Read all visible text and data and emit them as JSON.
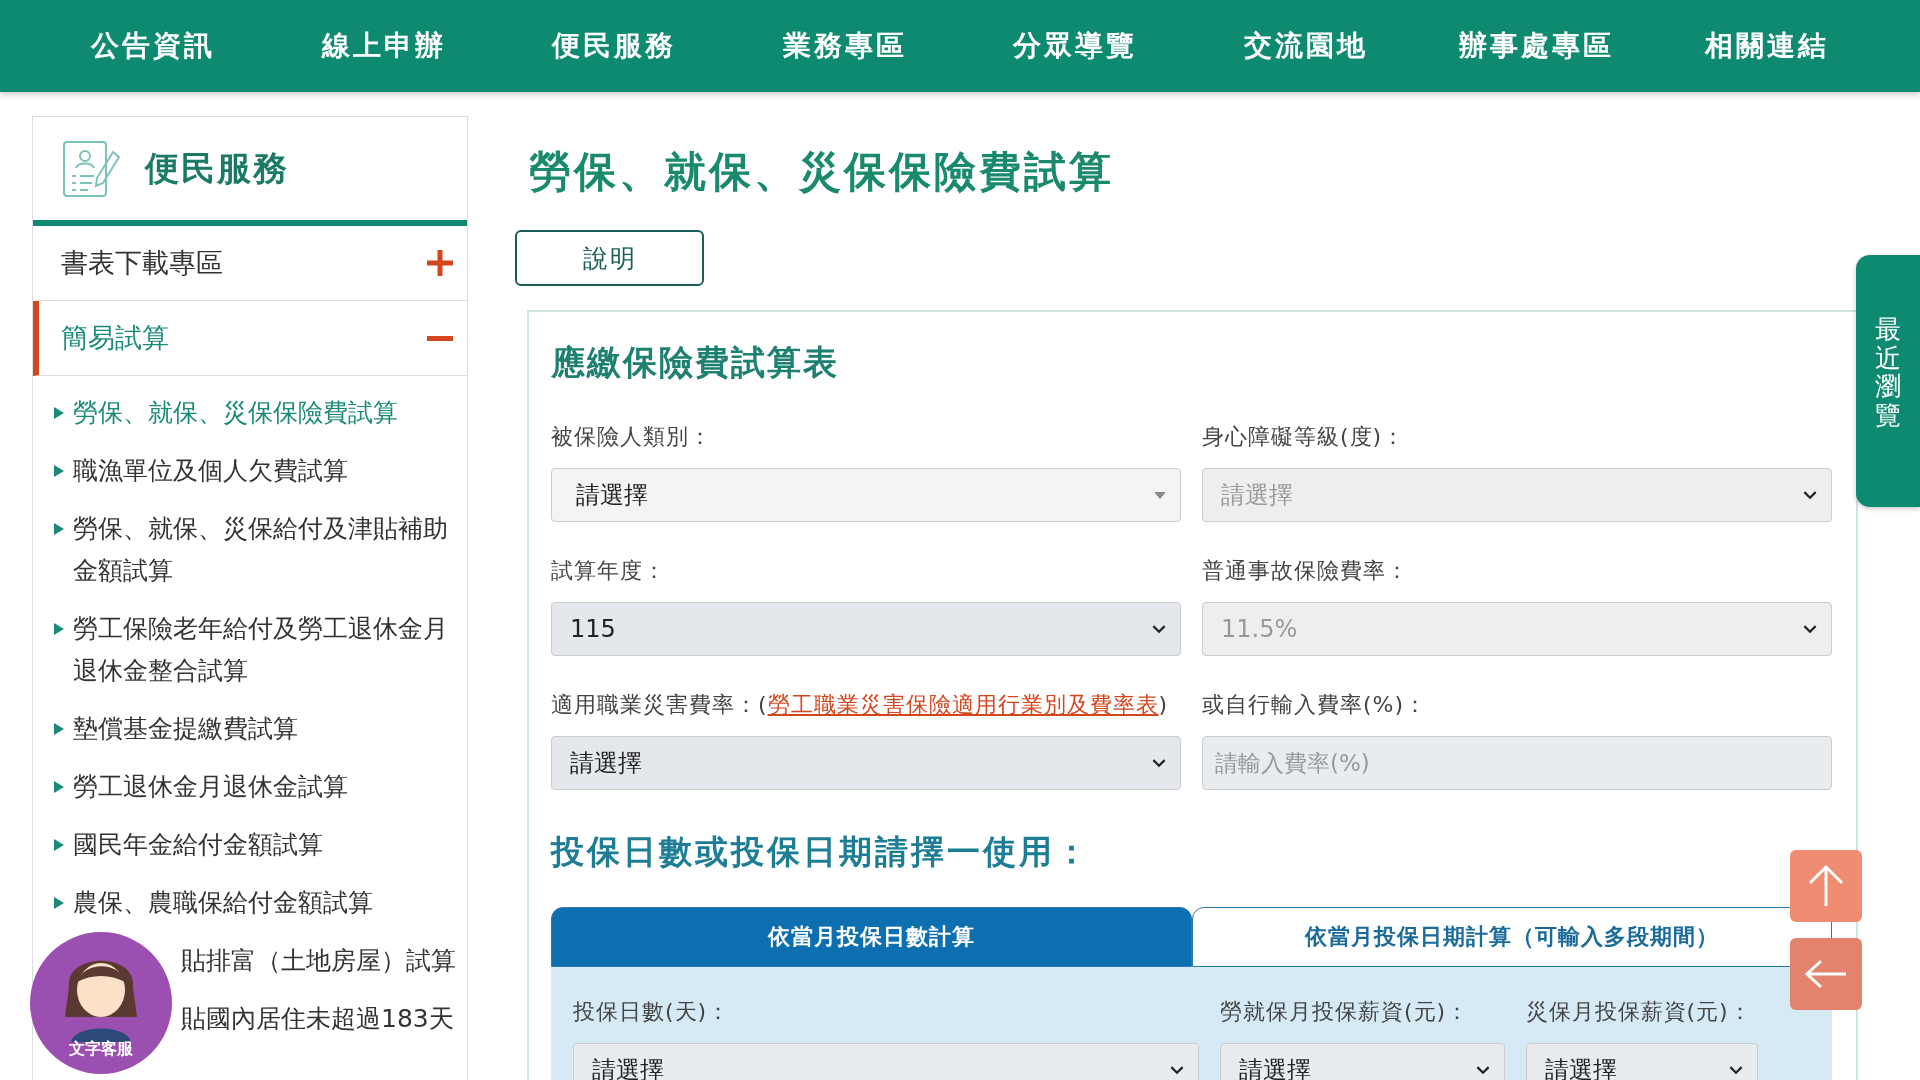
{
  "nav": {
    "items": [
      {
        "label": "公告資訊"
      },
      {
        "label": "線上申辦"
      },
      {
        "label": "便民服務"
      },
      {
        "label": "業務專區"
      },
      {
        "label": "分眾導覽"
      },
      {
        "label": "交流園地"
      },
      {
        "label": "辦事處專區"
      },
      {
        "label": "相關連結"
      }
    ]
  },
  "sidebar": {
    "title": "便民服務",
    "sections": [
      {
        "label": "書表下載專區",
        "expanded": false
      },
      {
        "label": "簡易試算",
        "expanded": true
      }
    ],
    "items": [
      {
        "label": "勞保、就保、災保保險費試算",
        "selected": true,
        "covered": false
      },
      {
        "label": "職漁單位及個人欠費試算",
        "selected": false,
        "covered": false
      },
      {
        "label": "勞保、就保、災保給付及津貼補助金額試算",
        "selected": false,
        "covered": false
      },
      {
        "label": "勞工保險老年給付及勞工退休金月退休金整合試算",
        "selected": false,
        "covered": false
      },
      {
        "label": "墊償基金提繳費試算",
        "selected": false,
        "covered": false
      },
      {
        "label": "勞工退休金月退休金試算",
        "selected": false,
        "covered": false
      },
      {
        "label": "國民年金給付金額試算",
        "selected": false,
        "covered": false
      },
      {
        "label": "農保、農職保給付金額試算",
        "selected": false,
        "covered": false
      },
      {
        "label": "貼排富（土地房屋）試算",
        "selected": false,
        "covered": true
      },
      {
        "label": "貼國內居住未超過183天",
        "selected": false,
        "covered": true
      }
    ]
  },
  "page": {
    "title": "勞保、就保、災保保險費試算",
    "help_button": "說明"
  },
  "form": {
    "title": "應繳保險費試算表",
    "fields": [
      {
        "label": "被保險人類別：",
        "kind": "dropdown",
        "value": "請選擇",
        "disabled": false
      },
      {
        "label": "身心障礙等級(度)：",
        "kind": "select",
        "value": "請選擇",
        "disabled": true
      },
      {
        "label": "試算年度：",
        "kind": "select",
        "value": "115",
        "disabled": false
      },
      {
        "label": "普通事故保險費率：",
        "kind": "select",
        "value": "11.5%",
        "disabled": true
      },
      {
        "label": "適用職業災害費率：(",
        "link": "勞工職業災害保險適用行業別及費率表",
        "label_end": ")",
        "kind": "select",
        "value": "請選擇",
        "disabled": false
      },
      {
        "label": "或自行輸入費率(%)：",
        "kind": "input",
        "placeholder": "請輸入費率(%)",
        "disabled": false
      }
    ],
    "section_title": "投保日數或投保日期請擇一使用：",
    "tabs": [
      {
        "label": "依當月投保日數計算",
        "selected": true
      },
      {
        "label": "依當月投保日期計算（可輸入多段期間）",
        "selected": false
      }
    ],
    "panel_fields": [
      {
        "label": "投保日數(天)：",
        "value": "請選擇"
      },
      {
        "label": "勞就保月投保薪資(元)：",
        "value": "請選擇"
      },
      {
        "label": "災保月投保薪資(元)：",
        "value": "請選擇"
      }
    ]
  },
  "side_tab": {
    "label": "最近瀏覽"
  },
  "chat": {
    "label": "文字客服"
  }
}
